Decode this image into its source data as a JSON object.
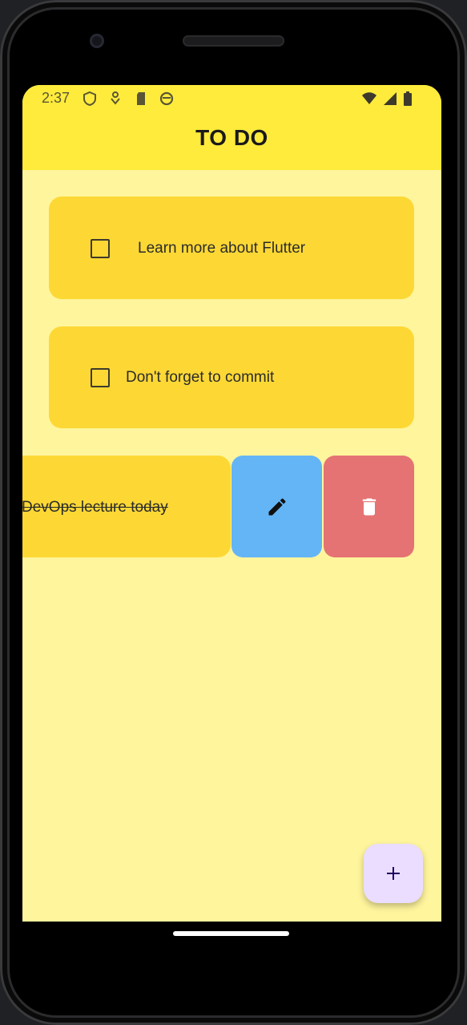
{
  "status_bar": {
    "time": "2:37",
    "left_icons": [
      "shield-icon",
      "download-icon",
      "sd-card-icon",
      "sync-icon"
    ],
    "right_icons": [
      "wifi-icon",
      "signal-icon",
      "battery-icon"
    ]
  },
  "app_bar": {
    "title": "TO DO",
    "color": "#ffeb3b"
  },
  "todos": [
    {
      "label": "Learn more about Flutter",
      "checked": false
    },
    {
      "label": "Don't forget to commit",
      "checked": false
    },
    {
      "label": "DevOps lecture today",
      "checked": true
    }
  ],
  "swipe_actions": {
    "edit_icon": "pencil-icon",
    "edit_color": "#64b5f6",
    "delete_icon": "trash-icon",
    "delete_color": "#e57373"
  },
  "fab": {
    "icon": "plus-icon",
    "color": "#eaddff"
  },
  "colors": {
    "background": "#fff59d",
    "card": "#fdd835"
  }
}
